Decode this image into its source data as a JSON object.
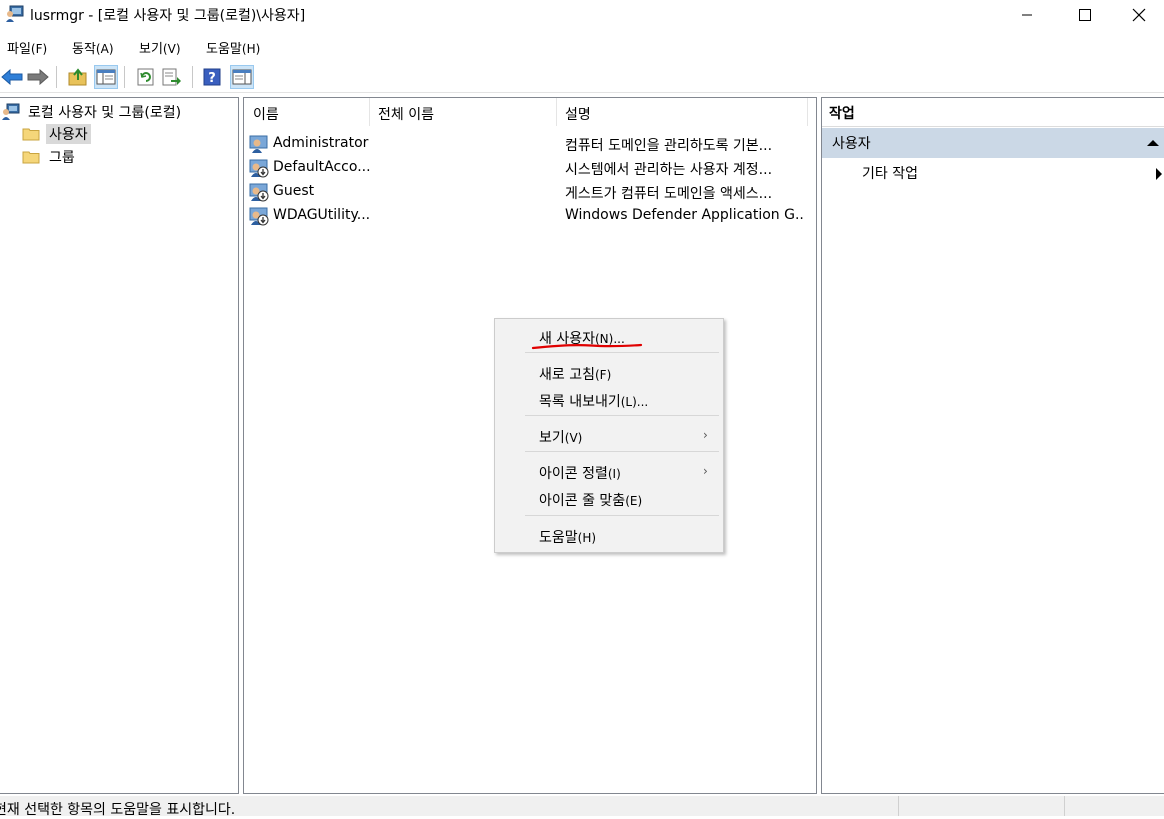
{
  "window": {
    "title": "lusrmgr - [로컬 사용자 및 그룹(로컬)\\사용자]",
    "min_icon": "minimize-icon",
    "max_icon": "maximize-icon",
    "close_icon": "close-icon"
  },
  "menubar": [
    {
      "label": "파일",
      "mnemonic": "(F)"
    },
    {
      "label": "동작",
      "mnemonic": "(A)"
    },
    {
      "label": "보기",
      "mnemonic": "(V)"
    },
    {
      "label": "도움말",
      "mnemonic": "(H)"
    }
  ],
  "toolbar": [
    "back-arrow-icon",
    "forward-arrow-icon",
    "up-folder-icon",
    "show-hide-tree-icon",
    "refresh-icon",
    "export-list-icon",
    "help-icon",
    "show-hide-action-pane-icon"
  ],
  "tree": {
    "root": "로컬 사용자 및 그룹(로컬)",
    "children": [
      "사용자",
      "그룹"
    ]
  },
  "list": {
    "columns": [
      "이름",
      "전체 이름",
      "설명"
    ],
    "rows": [
      {
        "name": "Administrator",
        "full_name": "",
        "description": "컴퓨터 도메인을 관리하도록 기본..."
      },
      {
        "name": "DefaultAcco...",
        "full_name": "",
        "description": "시스템에서 관리하는 사용자 계정..."
      },
      {
        "name": "Guest",
        "full_name": "",
        "description": "게스트가 컴퓨터 도메인을 액세스..."
      },
      {
        "name": "WDAGUtility...",
        "full_name": "",
        "description": "Windows Defender Application G..."
      }
    ]
  },
  "actions": {
    "header": "작업",
    "section": "사용자",
    "items": [
      "기타 작업"
    ]
  },
  "context_menu": {
    "new_user": {
      "label": "새 사용자",
      "mnemonic": "(N)..."
    },
    "refresh": {
      "label": "새로 고침",
      "mnemonic": "(F)"
    },
    "export": {
      "label": "목록 내보내기",
      "mnemonic": "(L)..."
    },
    "view": {
      "label": "보기",
      "mnemonic": "(V)"
    },
    "arrange": {
      "label": "아이콘 정렬",
      "mnemonic": "(I)"
    },
    "line_up": {
      "label": "아이콘 줄 맞춤",
      "mnemonic": "(E)"
    },
    "help": {
      "label": "도움말",
      "mnemonic": "(H)"
    },
    "submenu_arrow": "›",
    "annotation_color": "#e00000"
  },
  "status": {
    "text": "현재 선택한 항목의 도움말을 표시합니다."
  }
}
